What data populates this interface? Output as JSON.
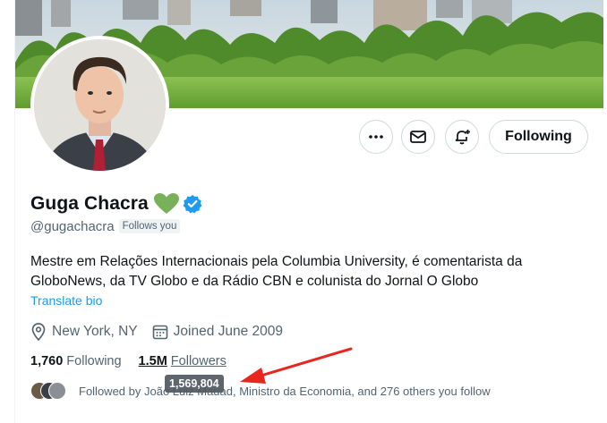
{
  "profile": {
    "display_name": "Guga Chacra",
    "handle": "@gugachacra",
    "follows_you_badge": "Follows you",
    "bio": "Mestre em Relações Internacionais pela Columbia University, é comentarista da GloboNews, da TV Globo e da Rádio CBN e colunista do Jornal O Globo",
    "translate_label": "Translate bio",
    "location": "New York, NY",
    "joined": "Joined June 2009"
  },
  "actions": {
    "following_label": "Following",
    "more_icon": "more-icon",
    "message_icon": "mail-icon",
    "notify_icon": "bell-plus-icon"
  },
  "counts": {
    "following_count": "1,760",
    "following_label": "Following",
    "followers_count": "1.5M",
    "followers_label": "Followers"
  },
  "followed_by": {
    "text": "Followed by João Luiz Mauad, Ministro da Economia, and 276 others you follow"
  },
  "tooltip": {
    "value": "1,569,804"
  },
  "colors": {
    "accent": "#1d9bf0",
    "arrow": "#e8261e",
    "heart": "#78b159",
    "verified": "#1d9bf0"
  }
}
